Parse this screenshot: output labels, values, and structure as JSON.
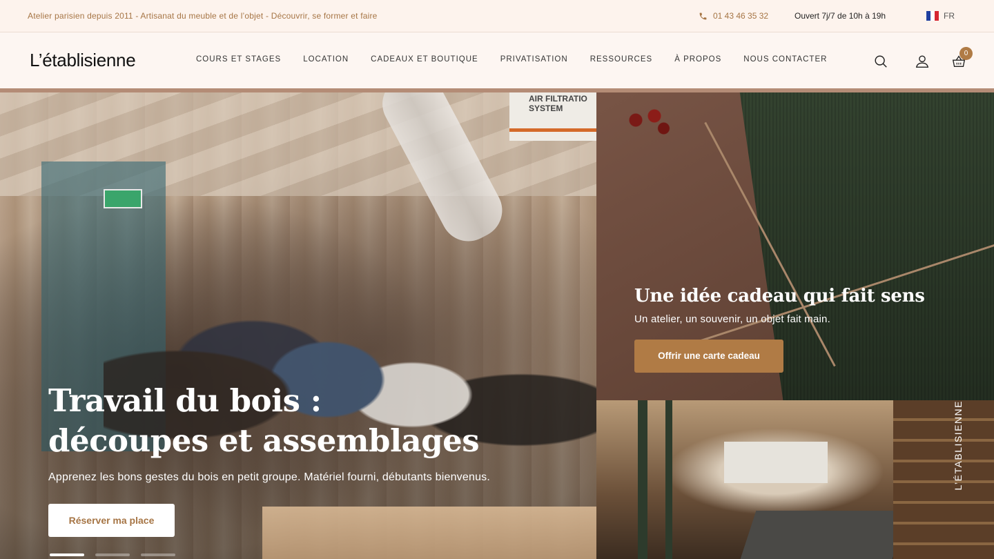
{
  "topbar": {
    "tagline": "Atelier parisien depuis 2011 - Artisanat du meuble et de l’objet - Découvrir, se former et faire",
    "phone": "01 43 46 35 32",
    "hours": "Ouvert 7j/7 de 10h à 19h",
    "lang": "FR"
  },
  "header": {
    "logo": "L’établisienne",
    "nav": [
      "COURS ET STAGES",
      "LOCATION",
      "CADEAUX ET BOUTIQUE",
      "PRIVATISATION",
      "RESSOURCES",
      "À PROPOS",
      "NOUS CONTACTER"
    ],
    "cart_count": "0"
  },
  "hero": {
    "title_line1": "Travail du bois :",
    "title_line2": "découpes et assemblages",
    "subtitle": "Apprenez les bons gestes du bois en petit groupe. Matériel fourni, débutants bienvenus.",
    "cta": "Réserver ma place",
    "sign_text": "AIR FILTRATIO SYSTEM",
    "slides_active": 1,
    "slides_total": 3
  },
  "promo": {
    "title": "Une idée cadeau qui fait sens",
    "subtitle": "Un atelier, un souvenir, un objet fait main.",
    "cta": "Offrir une carte cadeau"
  },
  "workshop": {
    "vertical_text": "L’ÉTABLISIENNE"
  },
  "colors": {
    "accent": "#b07b45",
    "topbar_bg": "#fdf3ed",
    "header_bg": "#fdf6f2",
    "divider": "#b48c76"
  }
}
